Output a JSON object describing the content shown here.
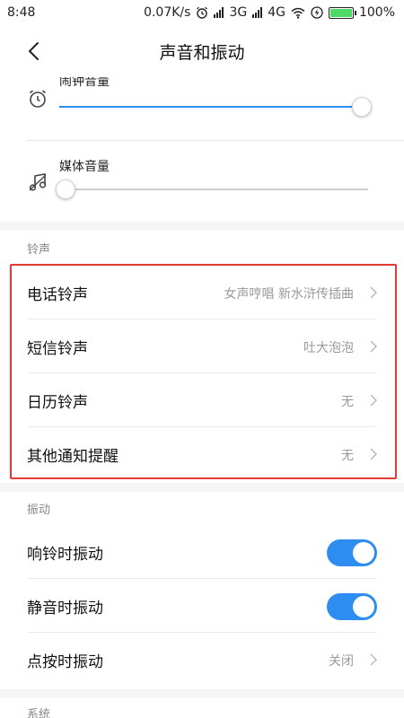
{
  "status_bar": {
    "time": "8:48",
    "speed": "0.07K/s",
    "network1": "3G",
    "network2": "4G",
    "battery": "100%"
  },
  "header": {
    "title": "声音和振动"
  },
  "volume": {
    "alarm": {
      "label": "闹钟音量",
      "level": 0.98
    },
    "media": {
      "label": "媒体音量",
      "level": 0.02
    }
  },
  "ringtone_section": {
    "label": "铃声",
    "items": [
      {
        "title": "电话铃声",
        "value": "女声哼唱 新水浒传插曲"
      },
      {
        "title": "短信铃声",
        "value": "吐大泡泡"
      },
      {
        "title": "日历铃声",
        "value": "无"
      },
      {
        "title": "其他通知提醒",
        "value": "无"
      }
    ]
  },
  "vibration_section": {
    "label": "振动",
    "items": [
      {
        "title": "响铃时振动",
        "toggle": true
      },
      {
        "title": "静音时振动",
        "toggle": true
      },
      {
        "title": "点按时振动",
        "value": "关闭"
      }
    ]
  },
  "system_section": {
    "label": "系统"
  },
  "colors": {
    "accent": "#2d8df0",
    "highlight": "#e53935",
    "battery": "#4cd964"
  }
}
